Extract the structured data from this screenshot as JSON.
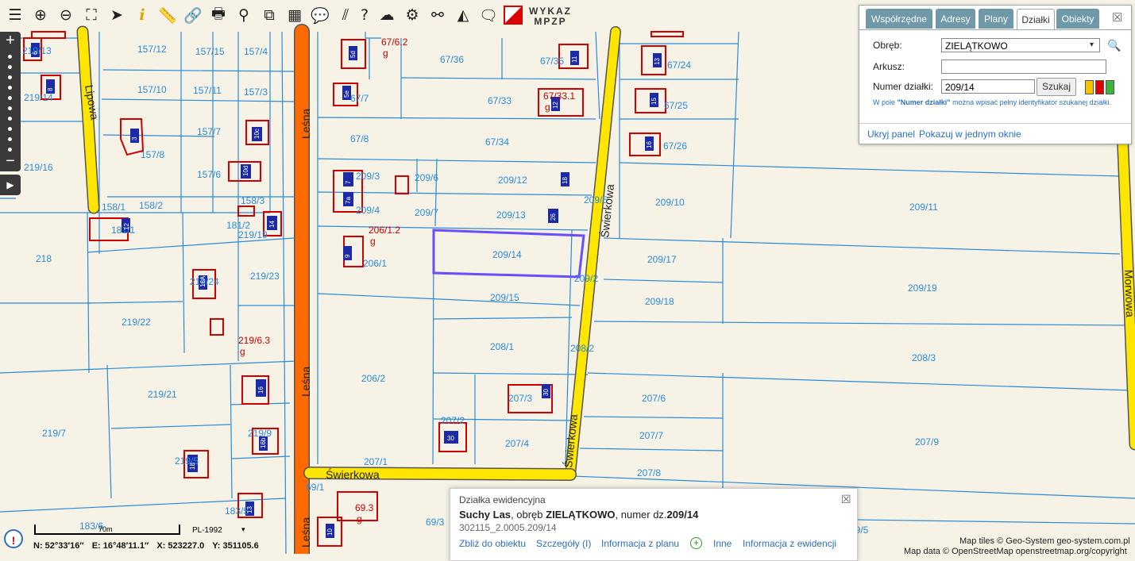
{
  "toolbar": {
    "wykaz_line1": "WYKAZ",
    "wykaz_line2": "MPZP",
    "tools": [
      "layers-icon",
      "zoom-in-icon",
      "zoom-out-icon",
      "zoom-extent-icon",
      "pointer-icon",
      "info-icon",
      "measure-icon",
      "link-icon",
      "print-icon",
      "pin-icon",
      "copy-icon",
      "layout-icon",
      "bubble-icon",
      "hatch-icon",
      "help-icon",
      "cloud-icon",
      "settings-icon",
      "search-map-icon",
      "area-icon",
      "comment-icon"
    ]
  },
  "panel": {
    "tabs": [
      "Współrzędne",
      "Adresy",
      "Plany",
      "Działki",
      "Obiekty"
    ],
    "active_tab": "Działki",
    "obreb_label": "Obręb:",
    "obreb_value": "ZIELĄTKOWO",
    "arkusz_label": "Arkusz:",
    "arkusz_value": "",
    "numer_label": "Numer działki:",
    "numer_value": "209/14",
    "szukaj_label": "Szukaj",
    "hint_prefix": "W pole ",
    "hint_bold": "\"Numer działki\"",
    "hint_suffix": " można wpisać pełny identyfikator szukanej działki.",
    "hide_link": "Ukryj panel",
    "single_window_link": "Pokazuj w jednym oknie",
    "swatch_colors": [
      "#f5c400",
      "#e00000",
      "#3fb23f"
    ]
  },
  "popup": {
    "title": "Działka ewidencyjna",
    "desc_place": "Suchy Las",
    "desc_mid": ", obręb ",
    "desc_obreb": "ZIELĄTKOWO",
    "desc_mid2": ", numer dz.",
    "desc_number": "209/14",
    "id": "302115_2.0005.209/14",
    "links": [
      "Zbliż do obiektu",
      "Szczegóły (I)",
      "Informacja z planu",
      "Inne",
      "Informacja z ewidencji"
    ]
  },
  "status": {
    "scale_label": "70m",
    "crs": "PL-1992",
    "n": "N: 52°33′16″",
    "e": "E: 16°48′11.1″",
    "x": "X: 523227.0",
    "y": "Y: 351105.6",
    "attribution1": "Map tiles © Geo-System geo-system.com.pl",
    "attribution2": "Map data © OpenStreetMap openstreetmap.org/copyright"
  },
  "map": {
    "streets": [
      "Lipowa",
      "Leśna",
      "Leśna",
      "Leśna",
      "Świerkowa",
      "Świerkowa",
      "Świerkowa",
      "Morwowa"
    ],
    "parcels": [
      "219/13",
      "157/12",
      "157/15",
      "157/4",
      "219/14",
      "157/10",
      "157/11",
      "157/3",
      "157/7",
      "157/8",
      "157/6",
      "219/16",
      "158/1",
      "158/2",
      "158/3",
      "181/1",
      "181/2",
      "218",
      "219/23",
      "219/24",
      "219/22",
      "219/21",
      "219/7",
      "219/9",
      "219/5",
      "183/5",
      "183/6",
      "67/36",
      "67/35",
      "67/24",
      "67/7",
      "67/33",
      "67/25",
      "67/8",
      "67/34",
      "67/26",
      "209/3",
      "209/6",
      "209/12",
      "209/4",
      "209/7",
      "209/13",
      "209/10",
      "209/11",
      "206/1",
      "209/14",
      "209/17",
      "209/15",
      "209/18",
      "209/19",
      "208/1",
      "208/3",
      "206/2",
      "207/3",
      "207/6",
      "207/2",
      "207/7",
      "207/4",
      "207/9",
      "207/1",
      "207/8",
      "69/1",
      "69/3",
      "69/5",
      "219/19",
      "209/5",
      "209/2",
      "208/2"
    ],
    "red_labels": [
      "67/6.2",
      "67/33.1",
      "206/1.2",
      "219/6.3",
      "69.3"
    ],
    "red_suffix": "g",
    "house_numbers": [
      "6",
      "8",
      "3",
      "5d",
      "5e",
      "10c",
      "10d",
      "7",
      "7a",
      "9",
      "12",
      "14",
      "16A",
      "16",
      "16b",
      "18",
      "13",
      "10",
      "11",
      "12",
      "13",
      "15",
      "16",
      "18",
      "26",
      "30"
    ],
    "selected_parcel": "209/14",
    "colors": {
      "parcel_line": "#2b8bd8",
      "building": "#d00000",
      "house_fill": "#1c2aa8",
      "road_yellow": "#ffe600",
      "road_orange": "#ff6a00",
      "selection": "#6a4dff"
    }
  }
}
